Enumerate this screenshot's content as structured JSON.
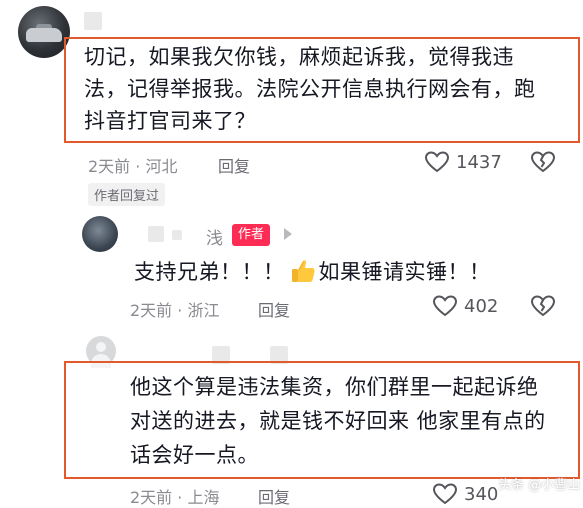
{
  "comment1": {
    "text_line1": "切记，如果我欠你钱，麻烦起诉我，觉得我违",
    "text_line2": "法，记得举报我。法院公开信息执行网会有，跑",
    "text_line3": "抖音打官司来了？",
    "time": "2天前 · 河北",
    "reply": "回复",
    "likes": "1437",
    "author_replied": "作者回复过",
    "icons": [
      "heart-icon",
      "dislike-icon"
    ]
  },
  "reply1": {
    "name_tail": "浅",
    "badge": "作者",
    "text_part1": "支持兄弟！！！",
    "text_part2": "如果锤请实锤！！",
    "time": "2天前 · 浙江",
    "reply": "回复",
    "likes": "402"
  },
  "comment2": {
    "text_line1": "他这个算是违法集资，你们群里一起起诉绝",
    "text_line2": "对送的进去，就是钱不好回来 他家里有点的",
    "text_line3": "话会好一点。",
    "time": "2天前 · 上海",
    "reply": "回复",
    "likes": "340"
  },
  "watermark": "头条 @小曹山",
  "colors": {
    "highlight": "#e15a2e",
    "author_badge": "#fe2c55",
    "meta": "#8a8b91"
  }
}
